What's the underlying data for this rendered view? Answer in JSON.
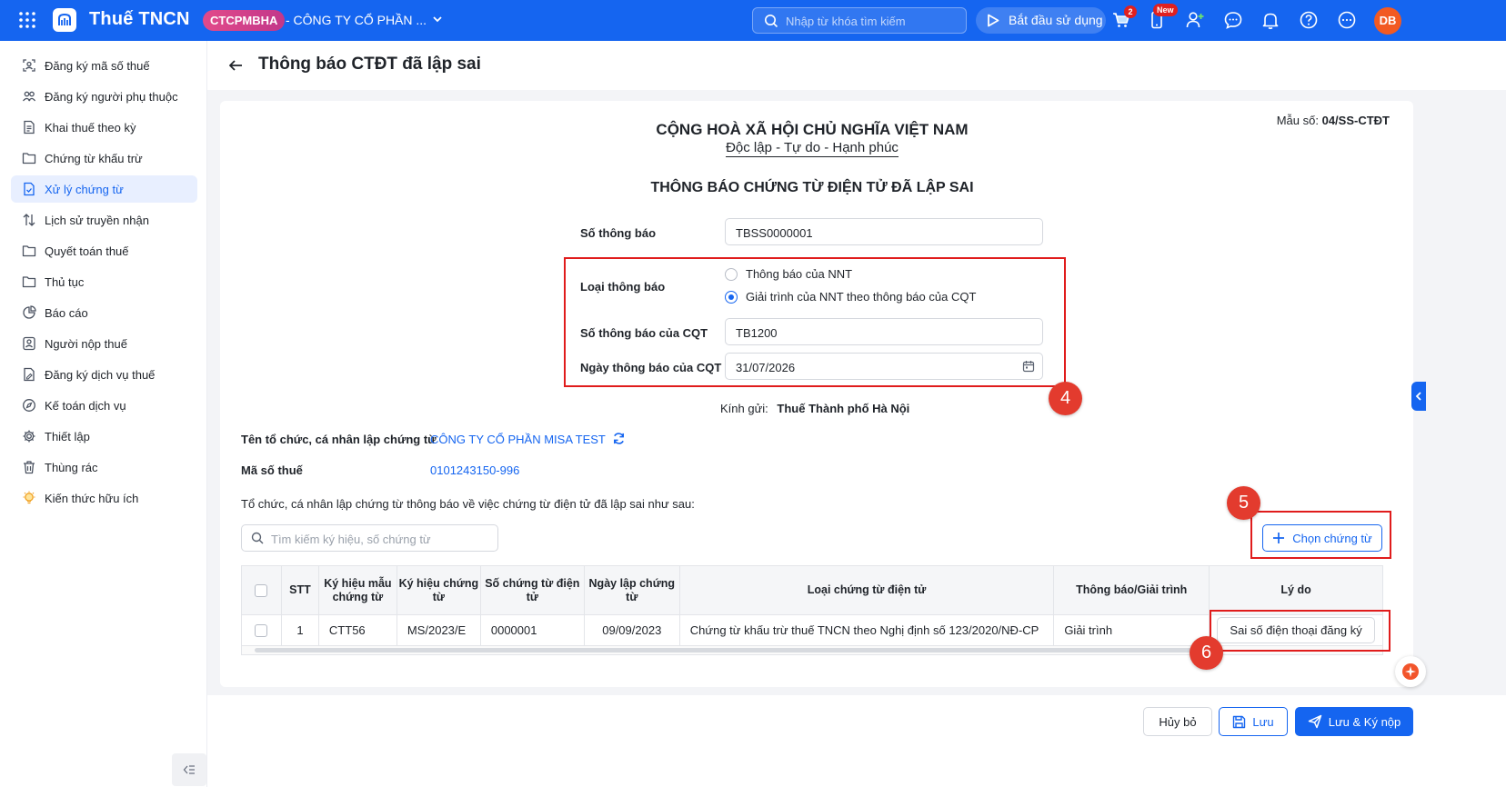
{
  "topbar": {
    "app_title": "Thuế TNCN",
    "company_badge": "CTCPMBHA",
    "company_name": "- CÔNG TY CỔ PHẦN ...",
    "search_placeholder": "Nhập từ khóa tìm kiếm",
    "start_label": "Bắt đầu sử dụng",
    "cart_count": "2",
    "new_badge": "New",
    "avatar_initials": "DB",
    "brand_color": "#1565f0"
  },
  "sidebar": {
    "items": [
      {
        "label": "Đăng ký mã số thuế",
        "icon": "user-scan-icon"
      },
      {
        "label": "Đăng ký người phụ thuộc",
        "icon": "users-icon"
      },
      {
        "label": "Khai thuế theo kỳ",
        "icon": "document-icon"
      },
      {
        "label": "Chứng từ khấu trừ",
        "icon": "folder-icon"
      },
      {
        "label": "Xử lý chứng từ",
        "icon": "document-check-icon"
      },
      {
        "label": "Lịch sử truyền nhận",
        "icon": "transfer-icon"
      },
      {
        "label": "Quyết toán thuế",
        "icon": "folder-icon"
      },
      {
        "label": "Thủ tục",
        "icon": "folder-icon"
      },
      {
        "label": "Báo cáo",
        "icon": "pie-chart-icon"
      },
      {
        "label": "Người nộp thuế",
        "icon": "person-card-icon"
      },
      {
        "label": "Đăng ký dịch vụ thuế",
        "icon": "document-edit-icon"
      },
      {
        "label": "Kế toán dịch vụ",
        "icon": "compass-icon"
      },
      {
        "label": "Thiết lập",
        "icon": "gear-icon"
      },
      {
        "label": "Thùng rác",
        "icon": "trash-icon"
      },
      {
        "label": "Kiến thức hữu ích",
        "icon": "lightbulb-icon"
      }
    ],
    "active_index": 4
  },
  "page": {
    "title": "Thông báo CTĐT đã lập sai"
  },
  "form": {
    "code_label": "Mẫu số:",
    "code_value": "04/SS-CTĐT",
    "nation": "CỘNG HOÀ XÃ HỘI CHỦ NGHĨA VIỆT NAM",
    "motto": "Độc lập - Tự do - Hạnh phúc",
    "doc_title": "THÔNG BÁO CHỨNG TỪ ĐIỆN TỬ ĐÃ LẬP SAI",
    "notice_no_label": "Số thông báo",
    "notice_no_value": "TBSS0000001",
    "notice_type_label": "Loại thông báo",
    "notice_type_options": [
      "Thông báo của NNT",
      "Giải trình của NNT theo thông báo của CQT"
    ],
    "notice_type_selected": 1,
    "cqt_no_label": "Số thông báo của CQT",
    "cqt_no_value": "TB1200",
    "cqt_date_label": "Ngày thông báo của CQT",
    "cqt_date_value": "31/07/2026",
    "recipient_label": "Kính gửi:",
    "recipient_value": "Thuế Thành phố Hà Nội",
    "issuer_label": "Tên tổ chức, cá nhân lập chứng từ",
    "issuer_value": "CÔNG TY CỔ PHẦN MISA TEST",
    "tax_code_label": "Mã số thuế",
    "tax_code_value": "0101243150-996",
    "intro_text": "Tổ chức, cá nhân lập chứng từ thông báo về việc chứng từ điện tử đã lập sai như sau:",
    "search_placeholder": "Tìm kiếm ký hiệu, số chứng từ",
    "choose_button": "Chọn chứng từ"
  },
  "steps": [
    "4",
    "5",
    "6"
  ],
  "table": {
    "headers": [
      "STT",
      "Ký hiệu mẫu chứng từ",
      "Ký hiệu chứng từ",
      "Số chứng từ điện tử",
      "Ngày lập chứng từ",
      "Loại chứng từ điện tử",
      "Thông báo/Giải trình",
      "Lý do"
    ],
    "rows": [
      {
        "stt": "1",
        "template_symbol": "CTT56",
        "symbol": "MS/2023/E",
        "number": "0000001",
        "date": "09/09/2023",
        "type": "Chứng từ khấu trừ thuế TNCN theo Nghị định số 123/2020/NĐ-CP",
        "kind": "Giải trình",
        "reason": "Sai số điện thoại đăng ký"
      }
    ]
  },
  "footer": {
    "cancel": "Hủy bỏ",
    "save": "Lưu",
    "save_sign": "Lưu & Ký nộp"
  }
}
